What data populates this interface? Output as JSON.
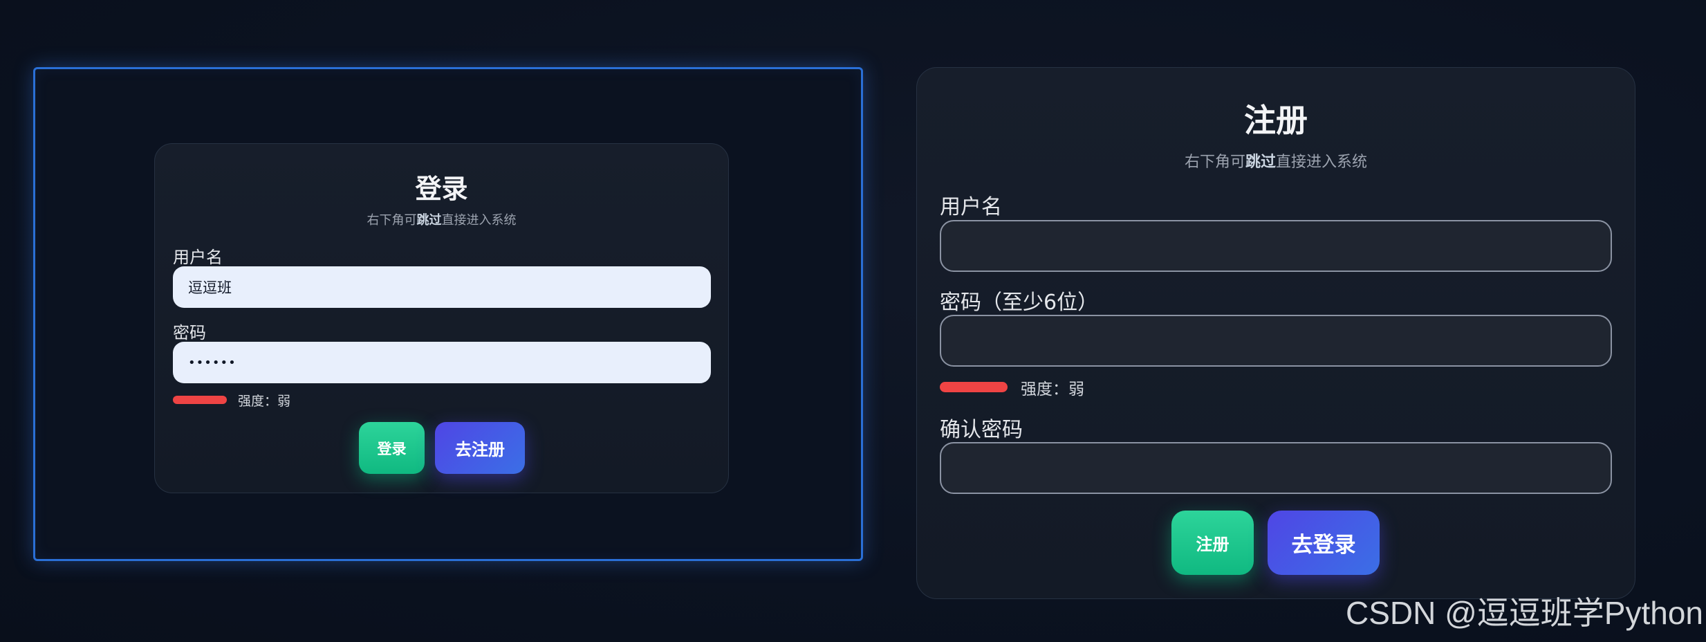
{
  "login": {
    "title": "登录",
    "subtitle_prefix": "右下角可",
    "subtitle_bold": "跳过",
    "subtitle_suffix": "直接进入系统",
    "username_label": "用户名",
    "username_value": "逗逗班",
    "password_label": "密码",
    "password_value": "••••••",
    "strength_text": "强度：弱",
    "strength_fraction": 0.15,
    "login_button": "登录",
    "to_register_button": "去注册"
  },
  "register": {
    "title": "注册",
    "subtitle_prefix": "右下角可",
    "subtitle_bold": "跳过",
    "subtitle_suffix": "直接进入系统",
    "username_label": "用户名",
    "username_value": "",
    "password_label": "密码（至少6位）",
    "password_value": "",
    "strength_text": "强度：弱",
    "strength_fraction": 0.15,
    "confirm_label": "确认密码",
    "confirm_value": "",
    "register_button": "注册",
    "to_login_button": "去登录"
  },
  "watermark": "CSDN @逗逗班学Python",
  "colors": {
    "background": "#0b1220",
    "frame_border": "#2a6fd6",
    "green_button": "#10b981",
    "blue_button": "#4f46e5",
    "strength_weak": "#ef4444"
  }
}
